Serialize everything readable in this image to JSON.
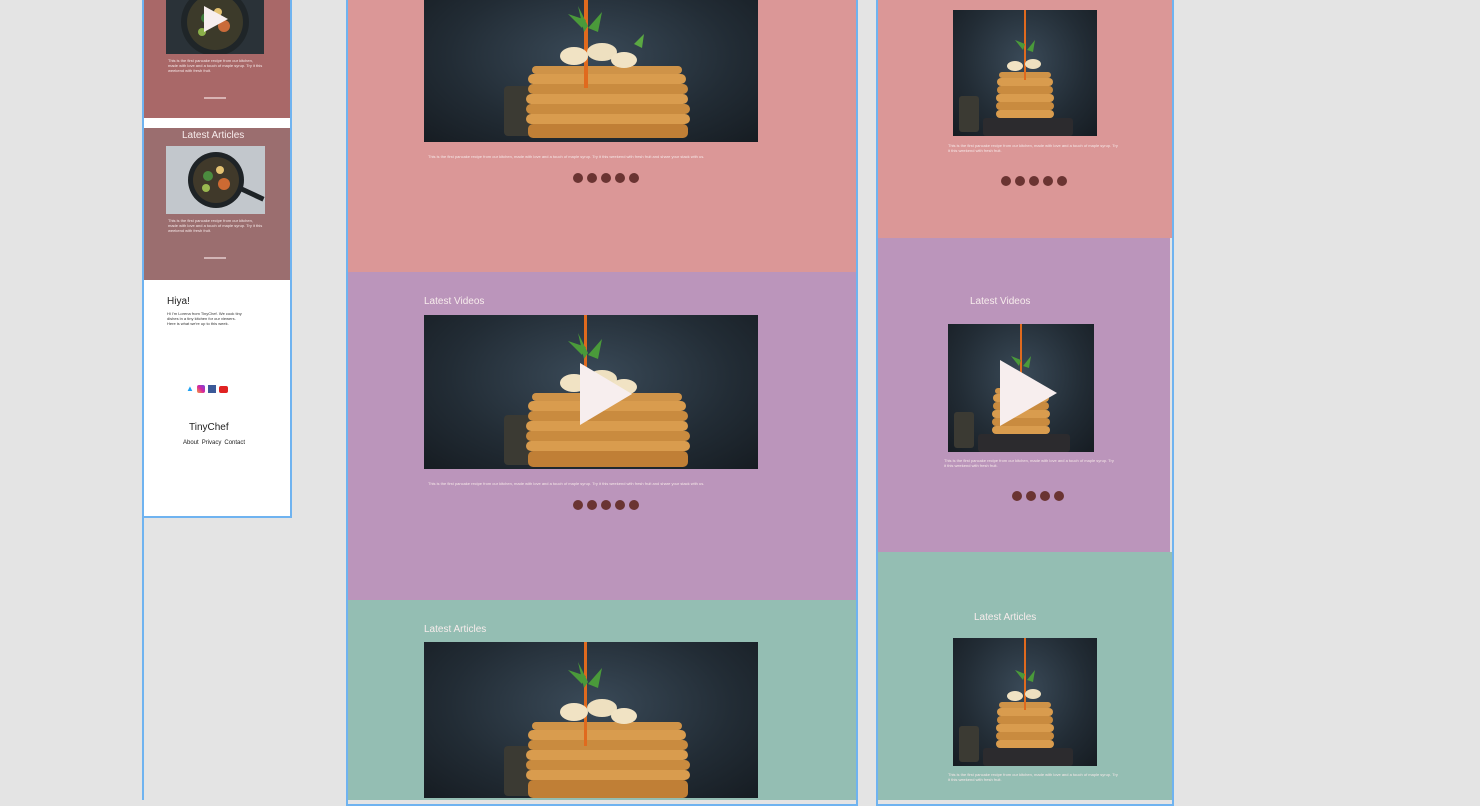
{
  "colors": {
    "canvas": "#e4e4e4",
    "frame_border": "#6fb3f0",
    "pink": "#db9797",
    "purple": "#bb95bb",
    "teal": "#94beb3",
    "mauve_top": "#a96868",
    "mauve": "#9b6e6f",
    "dot": "#6a3432"
  },
  "mobile": {
    "articles_heading": "Latest Articles",
    "intro_heading": "Hiya!",
    "intro_text": "Hi I'm Lorena from TinyChef. We cook tiny dishes in a tiny kitchen for our viewers. Here is what we're up to this week.",
    "social_icons": [
      "twitter-icon",
      "instagram-icon",
      "facebook-icon",
      "youtube-icon"
    ],
    "brand": "TinyChef",
    "footer_links": [
      "About",
      "Privacy",
      "Contact"
    ]
  },
  "desktop": {
    "top_text": "This is the first pancake recipe from our kitchen, made with love and a touch of maple syrup. Try it this weekend with fresh fruit and share your stack with us.",
    "videos_heading": "Latest Videos",
    "videos_text": "This is the first pancake recipe from our kitchen, made with love and a touch of maple syrup. Try it this weekend with fresh fruit and share your stack with us.",
    "articles_heading": "Latest Articles"
  },
  "tablet": {
    "top_text": "This is the first pancake recipe from our kitchen, made with love and a touch of maple syrup. Try it this weekend with fresh fruit.",
    "videos_heading": "Latest Videos",
    "videos_text": "This is the first pancake recipe from our kitchen, made with love and a touch of maple syrup. Try it this weekend with fresh fruit.",
    "articles_heading": "Latest Articles",
    "articles_text": "This is the first pancake recipe from our kitchen, made with love and a touch of maple syrup. Try it this weekend with fresh fruit."
  }
}
